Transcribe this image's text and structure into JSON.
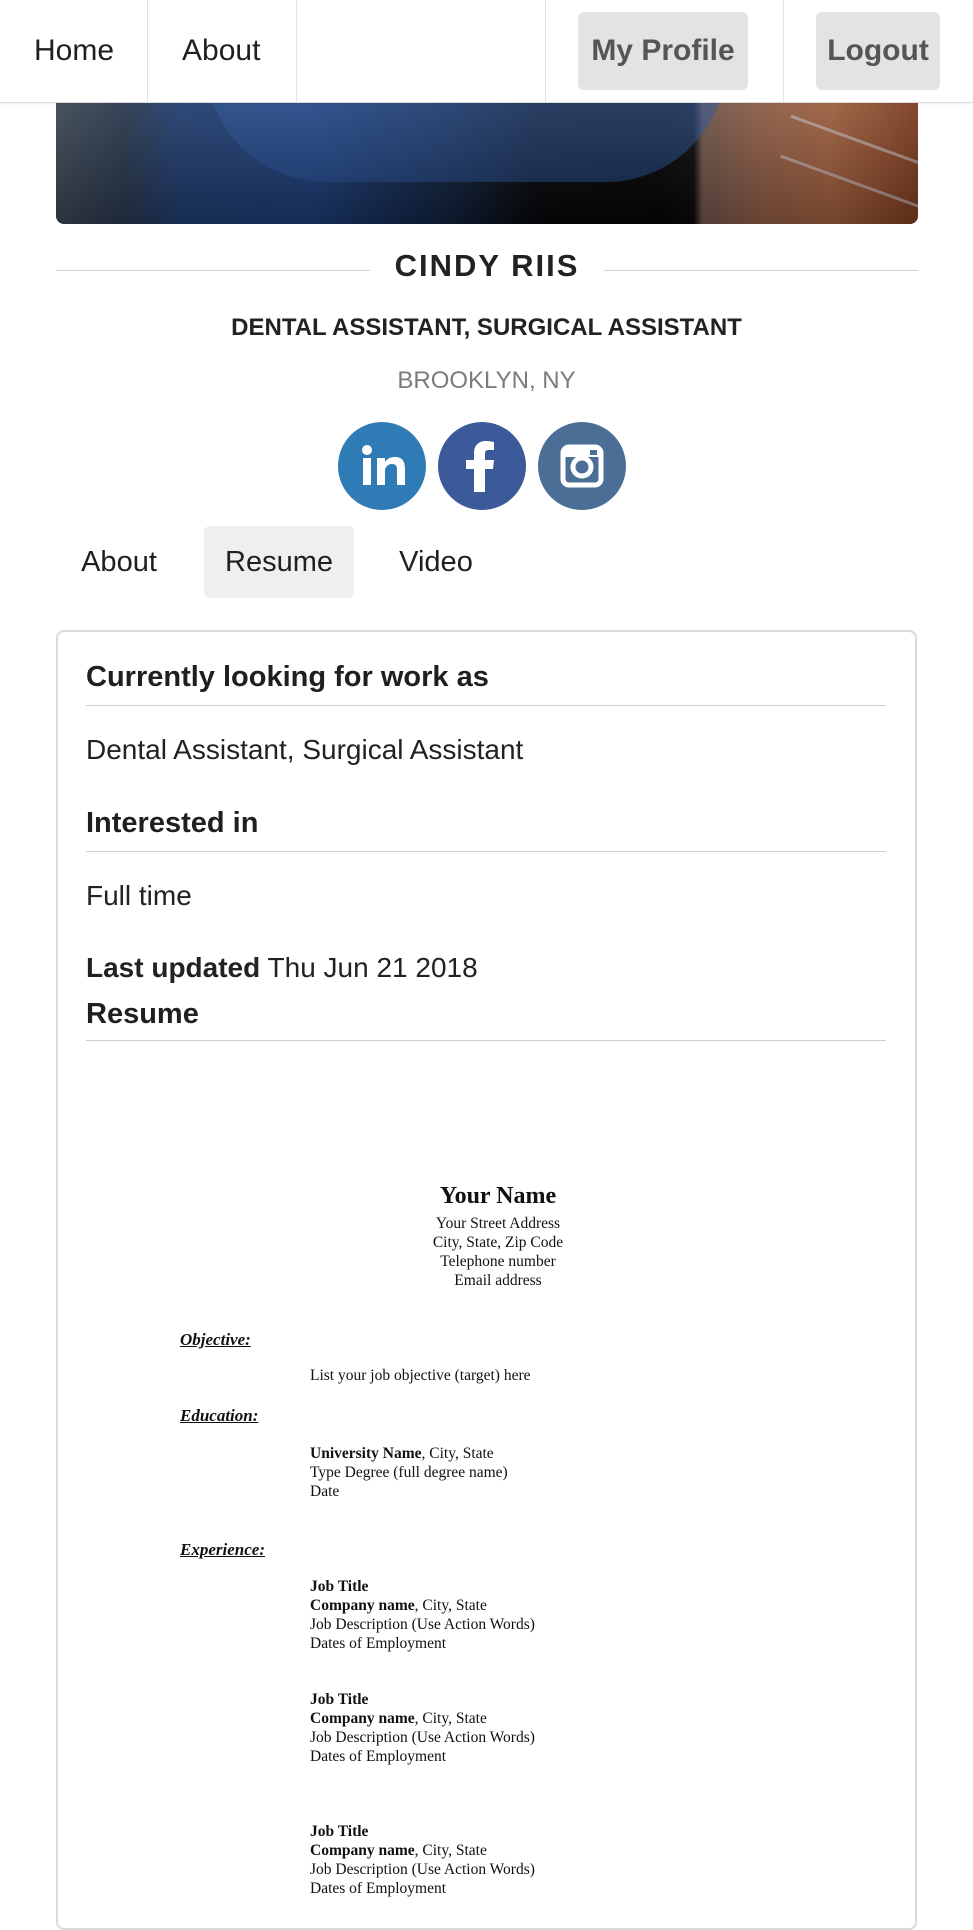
{
  "navbar": {
    "home": "Home",
    "about": "About",
    "my_profile": "My Profile",
    "logout": "Logout"
  },
  "profile": {
    "name": "CINDY RIIS",
    "headline": "DENTAL ASSISTANT, SURGICAL ASSISTANT",
    "location": "BROOKLYN, NY",
    "social_icons": [
      "linkedin-icon",
      "facebook-icon",
      "instagram-icon"
    ],
    "colors": {
      "linkedin": "#2f7bb5",
      "facebook": "#3c5a99",
      "instagram": "#4a6e96"
    }
  },
  "tabs": [
    {
      "label": "About",
      "active": false
    },
    {
      "label": "Resume",
      "active": true
    },
    {
      "label": "Video",
      "active": false
    }
  ],
  "card": {
    "looking_title": "Currently looking for work as",
    "looking_value": "Dental Assistant, Surgical Assistant",
    "interested_title": "Interested in",
    "interested_value": "Full time",
    "last_updated_label": "Last updated",
    "last_updated_value": "Thu Jun 21 2018",
    "resume_title": "Resume"
  },
  "resume_doc": {
    "name": "Your Name",
    "address_lines": [
      "Your Street Address",
      "City, State, Zip Code",
      "Telephone number",
      "Email address"
    ],
    "objective_heading": "Objective:",
    "objective_text": "List your job objective (target) here",
    "education_heading": "Education:",
    "education": {
      "school": "University Name",
      "school_suffix": ", City, State",
      "degree": "Type Degree (full degree name)",
      "date": "Date"
    },
    "experience_heading": "Experience:",
    "jobs": [
      {
        "title": "Job Title",
        "company": "Company name",
        "company_suffix": ", City, State",
        "description": "Job Description (Use Action Words)",
        "dates": "Dates of Employment"
      },
      {
        "title": "Job Title",
        "company": "Company name",
        "company_suffix": ", City, State",
        "description": "Job Description (Use Action Words)",
        "dates": "Dates of Employment"
      },
      {
        "title": "Job Title",
        "company": "Company name",
        "company_suffix": ", City, State",
        "description": "Job Description (Use Action Words)",
        "dates": "Dates of Employment"
      }
    ]
  }
}
